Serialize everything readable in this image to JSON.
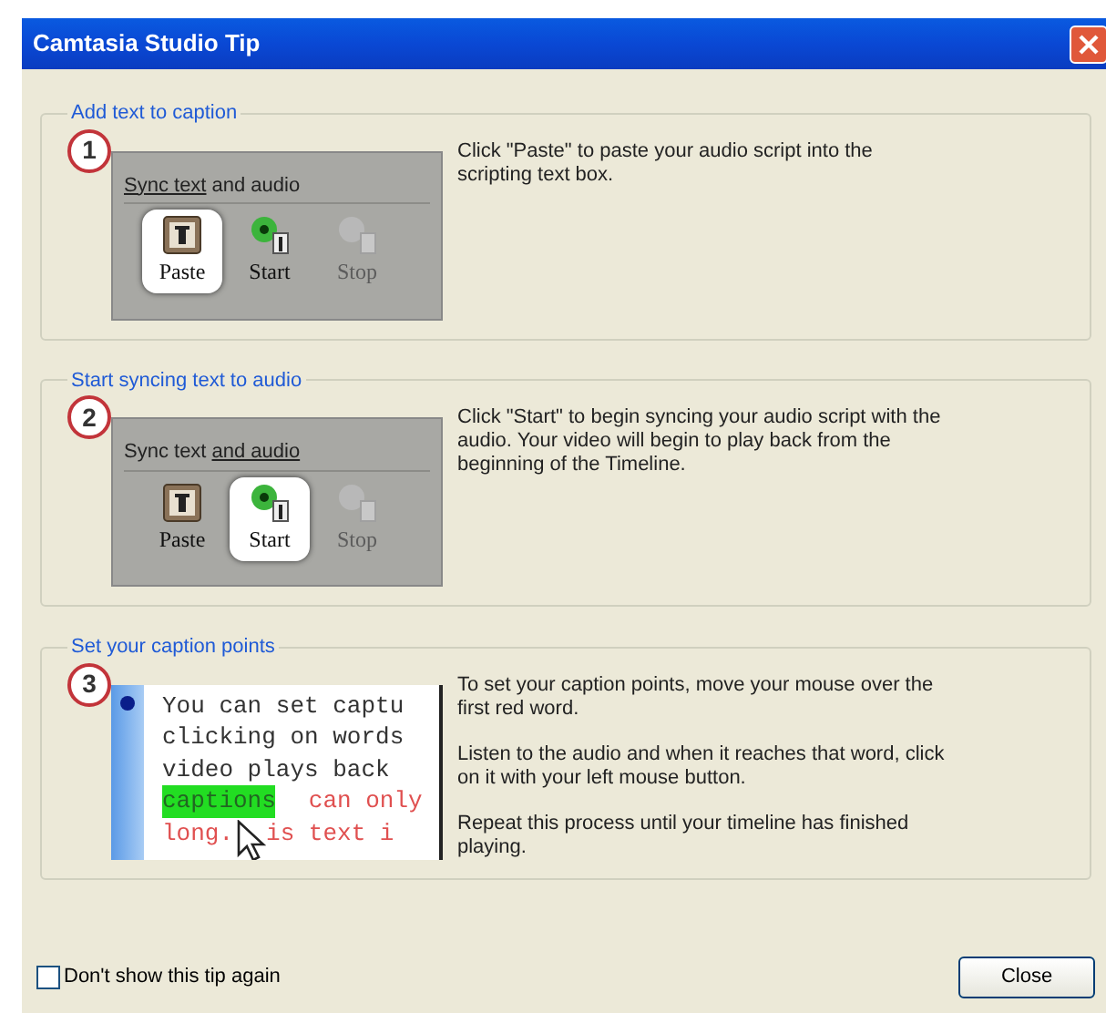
{
  "window": {
    "title": "Camtasia Studio Tip"
  },
  "steps": [
    {
      "heading": "Add text to caption",
      "number": "1",
      "kind": "toolbar",
      "toolbar": {
        "label_parts": [
          {
            "text": "Sync text",
            "underlined": true
          },
          {
            "text": "and audio",
            "underlined": false
          }
        ],
        "buttons": [
          {
            "label": "Paste",
            "selected": true,
            "disabled": false
          },
          {
            "label": "Start",
            "selected": false,
            "disabled": false
          },
          {
            "label": "Stop",
            "selected": false,
            "disabled": true
          }
        ]
      },
      "paragraphs": [
        "Click \"Paste\" to paste your audio script into the scripting text box."
      ]
    },
    {
      "heading": "Start syncing text to audio",
      "number": "2",
      "kind": "toolbar",
      "toolbar": {
        "label_parts": [
          {
            "text": "Sync text",
            "underlined": false
          },
          {
            "text": "and audio",
            "underlined": true
          }
        ],
        "buttons": [
          {
            "label": "Paste",
            "selected": false,
            "disabled": false
          },
          {
            "label": "Start",
            "selected": true,
            "disabled": false
          },
          {
            "label": "Stop",
            "selected": false,
            "disabled": true
          }
        ]
      },
      "paragraphs": [
        "Click \"Start\" to begin syncing your audio script with the audio.  Your video will begin to play back from the beginning of the Timeline."
      ]
    },
    {
      "heading": "Set your caption points",
      "number": "3",
      "kind": "script",
      "script": {
        "lines": [
          [
            {
              "text": "You can set captu",
              "kind": "plain"
            }
          ],
          [
            {
              "text": "clicking on words",
              "kind": "plain"
            }
          ],
          [
            {
              "text": "video plays back",
              "kind": "plain"
            }
          ],
          [
            {
              "text": "captions",
              "kind": "highlight"
            },
            {
              "text": "can only",
              "kind": "red"
            }
          ],
          [
            {
              "text": "long.",
              "kind": "red"
            },
            {
              "text": "is text i",
              "kind": "red"
            }
          ]
        ]
      },
      "paragraphs": [
        "To set your caption points, move your mouse over the first red word.",
        "Listen to the audio and when it reaches that word, click on it with your left mouse button.",
        "Repeat this process until your timeline has finished playing."
      ]
    }
  ],
  "dont_show_again": {
    "label": "Don't show this tip again",
    "checked": false
  },
  "buttons": [
    "Close"
  ]
}
